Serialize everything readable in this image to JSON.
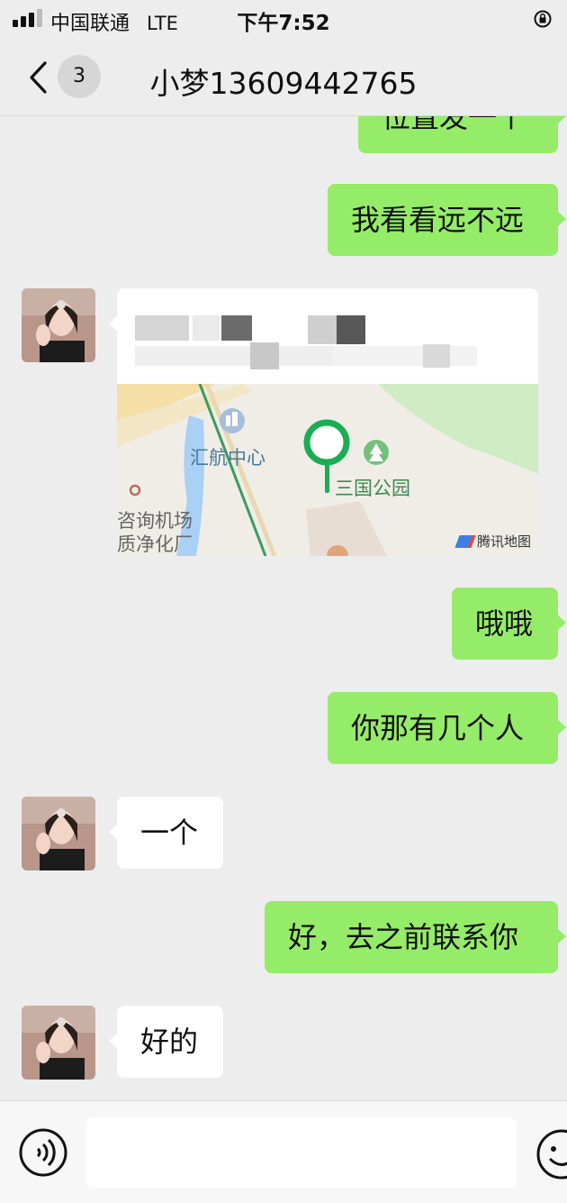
{
  "status_bar": {
    "carrier": "中国联通",
    "network": "LTE",
    "time": "下午7:52"
  },
  "header": {
    "unread_count": "3",
    "title": "小梦13609442765"
  },
  "messages": [
    {
      "side": "right",
      "type": "text",
      "text": "位置发一个"
    },
    {
      "side": "right",
      "type": "text",
      "text": "我看看远不远"
    },
    {
      "side": "left",
      "type": "location",
      "map_labels": [
        "汇航中心",
        "三国公园",
        "咨询机场",
        "质净化厂"
      ],
      "map_provider": "腾讯地图"
    },
    {
      "side": "right",
      "type": "text",
      "text": "哦哦"
    },
    {
      "side": "right",
      "type": "text",
      "text": "你那有几个人"
    },
    {
      "side": "left",
      "type": "text",
      "text": "一个"
    },
    {
      "side": "right",
      "type": "text",
      "text": "好，去之前联系你"
    },
    {
      "side": "left",
      "type": "text",
      "text": "好的"
    }
  ],
  "colors": {
    "sent_bubble": "#95ec69",
    "received_bubble": "#ffffff",
    "background": "#ededed",
    "pin": "#1aad54"
  },
  "icons": [
    "signal-icon",
    "lock-rotation-icon",
    "back-chevron-icon",
    "voice-icon",
    "emoji-icon",
    "map-pin-icon",
    "building-icon",
    "park-icon"
  ]
}
